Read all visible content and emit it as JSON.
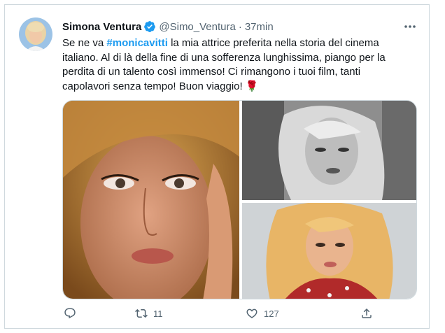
{
  "tweet": {
    "display_name": "Simona Ventura",
    "handle": "@Simo_Ventura",
    "separator": "·",
    "time": "37min",
    "text_before": "Se ne va ",
    "hashtag": "#monicavitti",
    "text_after": " la mia attrice preferita nella storia del cinema italiano. Al di là della fine di una sofferenza lunghissima, piango per la perdita di un talento così immenso! Ci  rimangono i tuoi film, tanti capolavori senza tempo! Buon viaggio! 🌹",
    "accent_color": "#1d9bf0",
    "verified": true
  },
  "media": [
    {
      "description": "portrait-closeup-color"
    },
    {
      "description": "portrait-black-and-white"
    },
    {
      "description": "portrait-color-red-blouse"
    }
  ],
  "actions": {
    "reply_icon": "reply-icon",
    "retweet_icon": "retweet-icon",
    "retweet_count": "11",
    "like_icon": "heart-icon",
    "like_count": "127",
    "share_icon": "share-icon"
  }
}
